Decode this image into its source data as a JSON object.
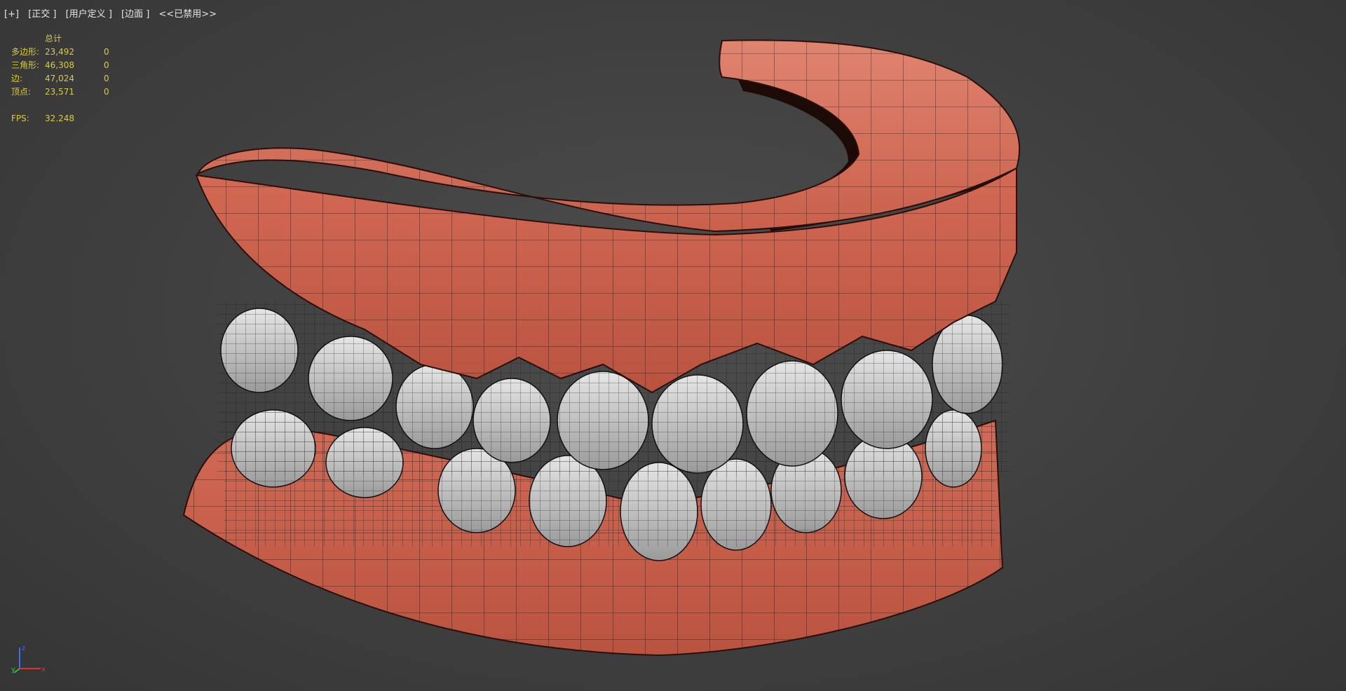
{
  "viewport_label": {
    "plus": "[+]",
    "view": "[正交 ]",
    "camera": "[用户定义 ]",
    "shading": "[边面 ]",
    "disabled": "<<已禁用>>"
  },
  "stats": {
    "header": "总计",
    "rows": [
      {
        "label": "多边形:",
        "total": "23,492",
        "selected": "0"
      },
      {
        "label": "三角形:",
        "total": "46,308",
        "selected": "0"
      },
      {
        "label": "边:",
        "total": "47,024",
        "selected": "0"
      },
      {
        "label": "顶点:",
        "total": "23,571",
        "selected": "0"
      }
    ],
    "fps_label": "FPS:",
    "fps_value": "32.248"
  },
  "axis": {
    "z": "z",
    "x": "x",
    "y": "y"
  },
  "colors": {
    "gum": "#d9725e",
    "gum_dark": "#8e3a2c",
    "tooth": "#cfcfcf",
    "wire": "#111111",
    "stat_text": "#d9c94a"
  }
}
